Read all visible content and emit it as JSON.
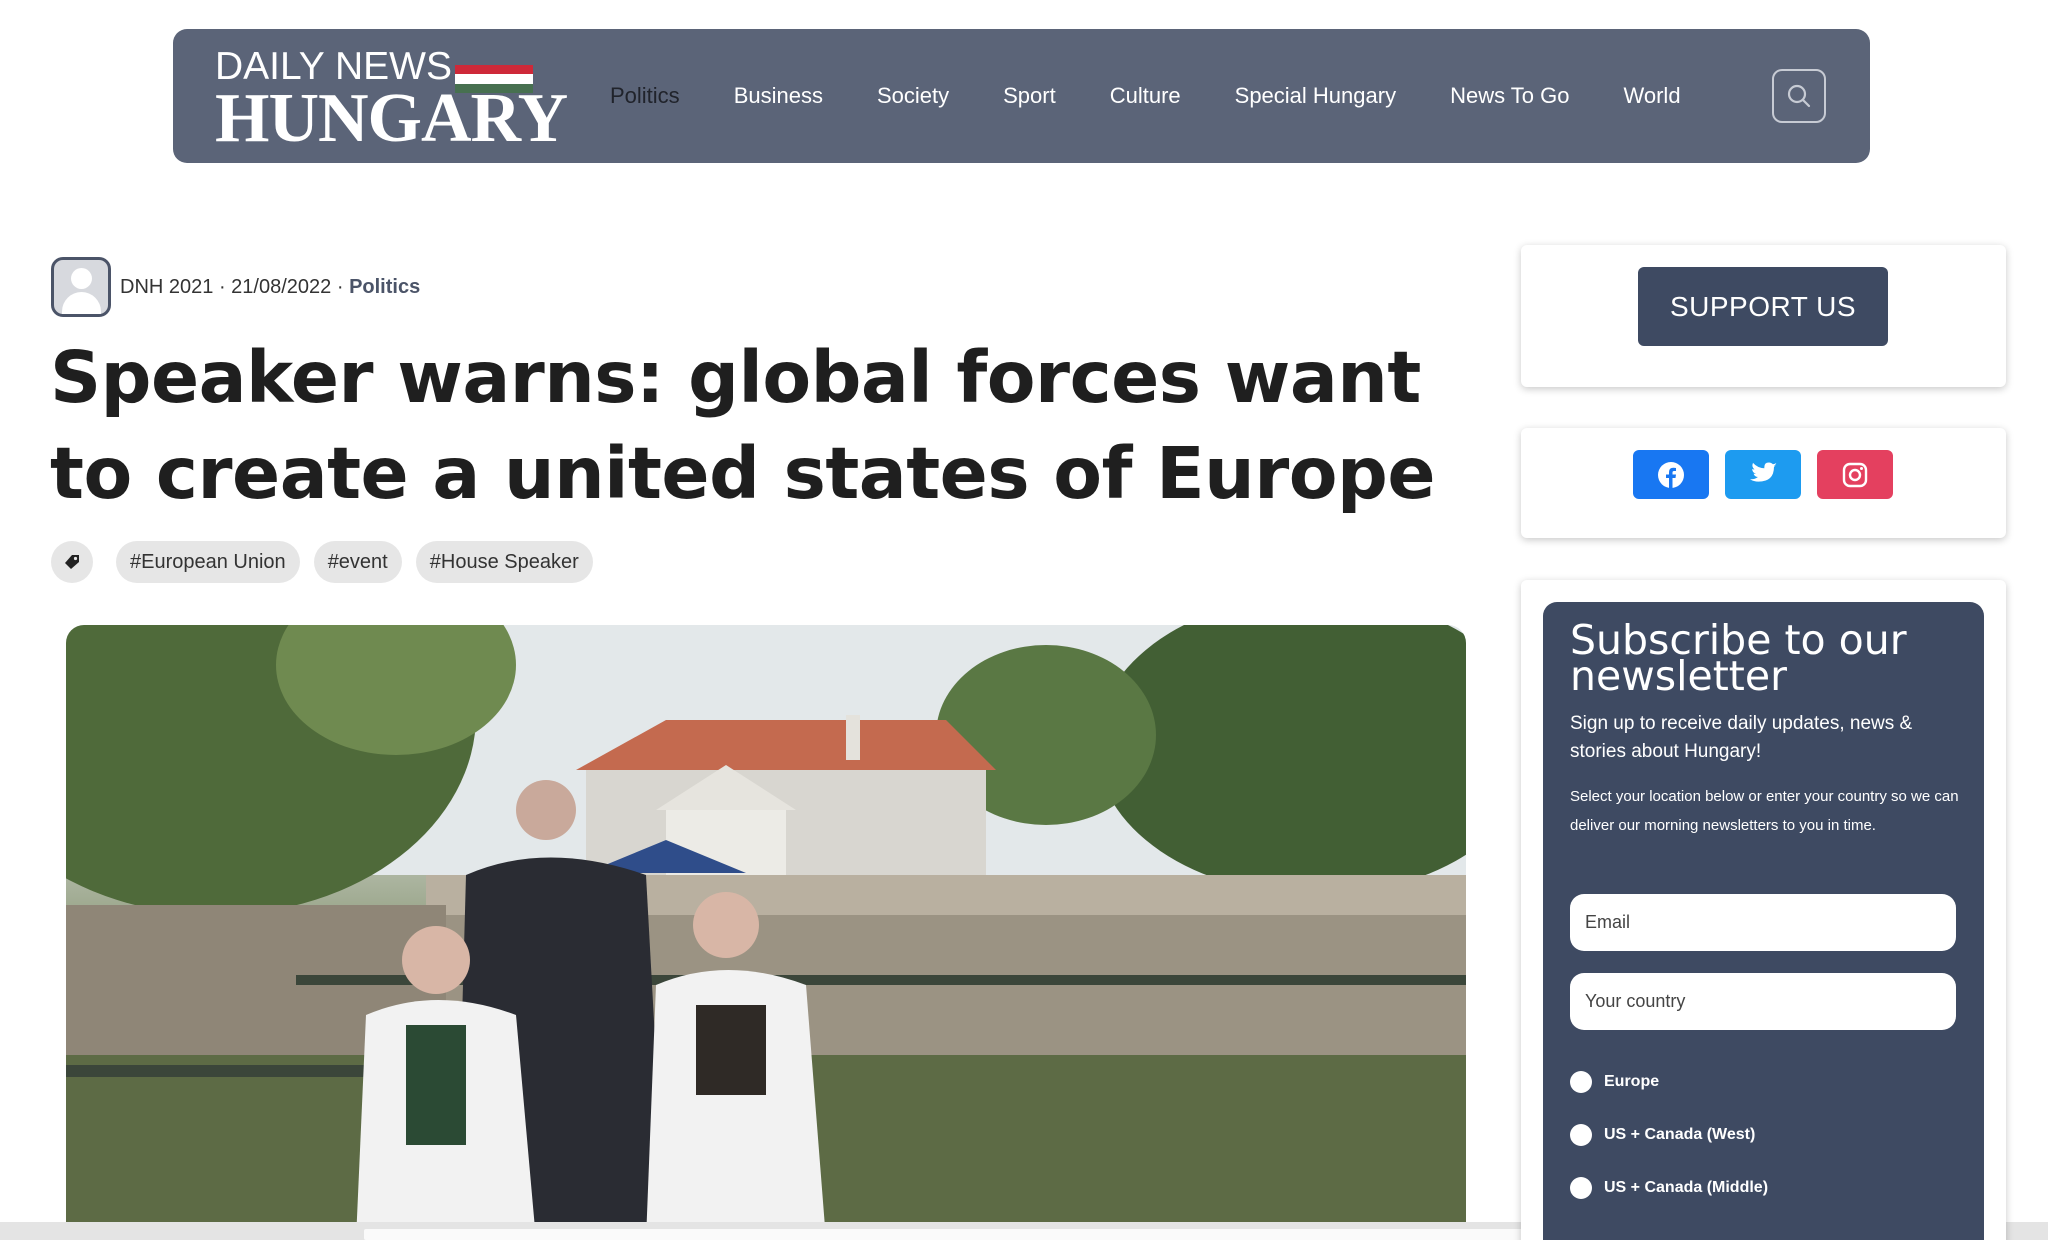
{
  "header": {
    "logo_top": "DAILY NEWS",
    "logo_bottom": "HUNGARY",
    "flag_colors": [
      "#ce2939",
      "#ffffff",
      "#477050"
    ],
    "nav": [
      "Politics",
      "Business",
      "Society",
      "Sport",
      "Culture",
      "Special Hungary",
      "News To Go",
      "World"
    ],
    "active_nav": "Politics",
    "search_icon": "search-icon"
  },
  "article": {
    "author": "DNH 2021",
    "date": "21/08/2022",
    "category": "Politics",
    "title": "Speaker warns: global forces want to create a united states of Europe",
    "tag_icon": "tag-icon",
    "tags": [
      "#European Union",
      "#event",
      "#House Speaker"
    ]
  },
  "sidebar": {
    "support_label": "SUPPORT US",
    "social": [
      {
        "name": "facebook-icon",
        "color": "#1877f2"
      },
      {
        "name": "twitter-icon",
        "color": "#1d9bf0"
      },
      {
        "name": "instagram-icon",
        "color": "#e4405f"
      }
    ],
    "newsletter": {
      "title": "Subscribe to our newsletter",
      "subtitle": "Sign up to receive daily updates, news & stories about Hungary!",
      "note": "Select your location below or enter your country so we can deliver our morning newsletters to you in time.",
      "email_placeholder": "Email",
      "country_placeholder": "Your country",
      "regions": [
        "Europe",
        "US + Canada (West)",
        "US + Canada (Middle)"
      ]
    }
  },
  "colors": {
    "header_bg": "#5b6478",
    "accent": "#3e4a62"
  }
}
